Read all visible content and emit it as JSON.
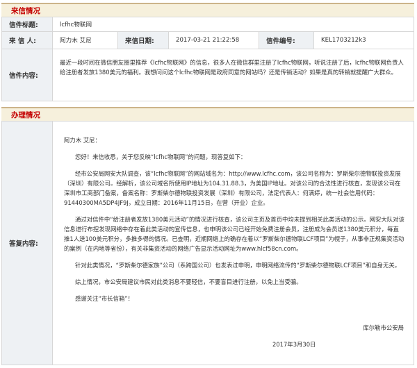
{
  "sections": {
    "letter_info": "来信情况",
    "handling_info": "办理情况"
  },
  "letter": {
    "title_label": "信件标题:",
    "title_value": "lcfhc物联网",
    "sender_label": "来 信 人:",
    "sender_value": "阿力木 艾尼",
    "date_label": "来信日期:",
    "date_value": "2017-03-21 21:22:58",
    "number_label": "信件编号:",
    "number_value": "KEL1703212k3",
    "content_label": "信件内容:",
    "content_value": "最近一段时间在微信朋友圈里推荐《lcfhc物联网》的信息，很多人在微信群里注册了lcfhc物联网，听说注册了后，lcfhc物联网负责人给注册者发放1380美元的福利。我想问问这个lcfhc物联网是政府同意的网站吗？还是传销活动？如果是真的转销就提醒广大群众。"
  },
  "reply": {
    "label": "答复内容:",
    "greeting": "阿力木 艾尼：",
    "p1": "您好！来信收悉，关于您反映“lcfhc物联网”的问题，现答复如下：",
    "p2": "经市公安局网安大队调查，该“lcfhc物联网”的网站域名为：http://www.lcfhc.com，该公司名称为：罗斯柴尔德物联投资发展（深圳）有限公司。经解析，该公司域名所使用IP地址为104.31.88.3，为美国IP地址。对该公司的合法性进行核查，发现该公司在深圳市工商部门备案，备案名称：罗斯柴尔德物联投资发展（深圳）有限公司，法定代表人：何满婷，统一社会信用代码：91440300MA5DP4JF9J，成立日期：2016年11月15日，在营（开业）企业。",
    "p3": "通过对信件中“给注册者发放1380美元活动”的情况进行核查，该公司主页及首页中均未提到相关此类活动的公示。网安大队对该信息进行布控发现网络中存在着此类活动的宣传信息，也申明该公司已经开始免费注册会员，注册成为会员送1380美元积分，每直推1人送100美元积分，多推多得的情况。已查明，近期网络上的确存在着以“罗斯柴尔德物联LCF项目”为幌子，从事非正规集资活动的案例（在内地等省份），有关非集资活动的网络广告显示活动网址为www.hlcf58cn.com。",
    "p4": "针对此类情况，“罗斯柴尔德家族”公司（系跨国公司）也发表过申明，申明网络流传的“罗斯柴尔德物联LCF项目”和自身无关。",
    "p5": "综上情况，市公安局建议市民对此类消息不要轻信，不要盲目进行注册，以免上当受骗。",
    "p6": "感谢关注“市长信箱”！",
    "signature": "库尔勒市公安局",
    "date": "2017年3月30日"
  }
}
